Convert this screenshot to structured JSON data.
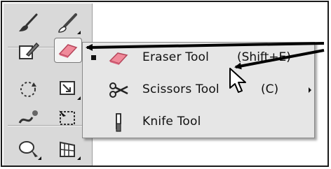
{
  "toolbar": {
    "tools": [
      {
        "name": "brush-tool",
        "icon": "brush-icon"
      },
      {
        "name": "blob-brush-tool",
        "icon": "blob-brush-icon"
      },
      {
        "name": "shaper-tool",
        "icon": "shaper-icon"
      },
      {
        "name": "eraser-tool-button",
        "icon": "eraser-icon",
        "active": true
      },
      {
        "name": "rotate-tool",
        "icon": "rotate-icon"
      },
      {
        "name": "scale-tool",
        "icon": "scale-icon"
      },
      {
        "name": "warp-tool",
        "icon": "warp-icon"
      },
      {
        "name": "free-transform-tool",
        "icon": "free-transform-icon"
      },
      {
        "name": "shape-builder-tool",
        "icon": "shape-builder-icon"
      },
      {
        "name": "perspective-grid-tool",
        "icon": "perspective-grid-icon"
      }
    ]
  },
  "flyout": {
    "items": [
      {
        "label": "Eraser Tool",
        "shortcut": "(Shift+E)",
        "selected": true,
        "icon": "eraser-icon"
      },
      {
        "label": "Scissors Tool",
        "shortcut": "(C)",
        "selected": false,
        "icon": "scissors-icon"
      },
      {
        "label": "Knife Tool",
        "shortcut": "",
        "selected": false,
        "icon": "knife-icon"
      }
    ]
  },
  "colors": {
    "toolbar_bg": "#d9d9d9",
    "menu_bg": "#e6e6e6",
    "eraser_pink": "#f08a9a",
    "annotation_arrow": "#000000"
  }
}
